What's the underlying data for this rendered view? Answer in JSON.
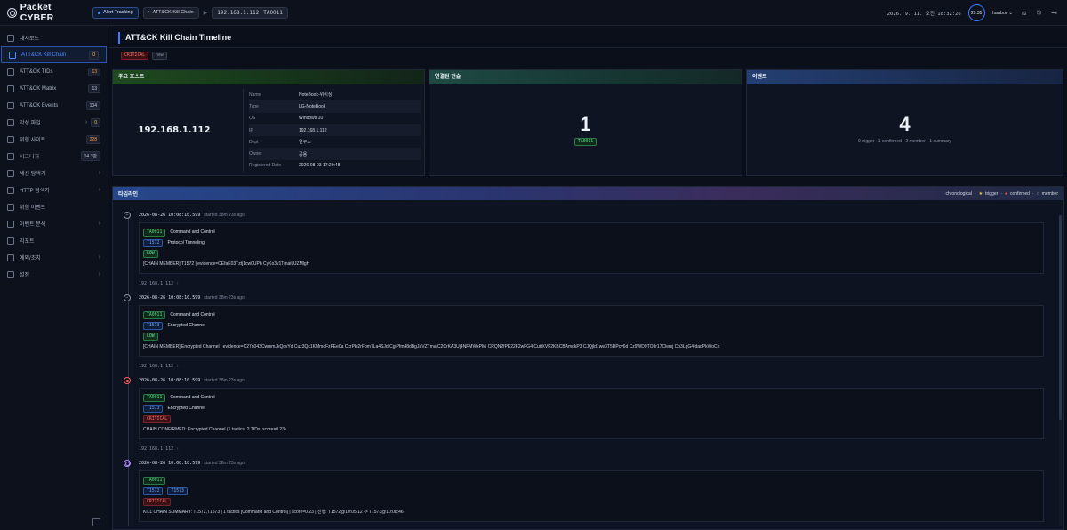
{
  "app": {
    "logo": "Packet CYBER"
  },
  "topbar": {
    "alert_label": "Alert Tracking",
    "chain_label": "ATT&CK Kill Chain",
    "ip": "192.168.1.112",
    "tactic": "TA0011",
    "datetime": "2026. 9. 11. 오전 10:32:26",
    "timer": "29:35",
    "user": "hanbor"
  },
  "sidebar": {
    "items": [
      {
        "label": "대시보드"
      },
      {
        "label": "ATT&CK Kill Chain",
        "badge": "0"
      },
      {
        "label": "ATT&CK TIDs",
        "badge": "13"
      },
      {
        "label": "ATT&CK Matrix",
        "badge": "13"
      },
      {
        "label": "ATT&CK Events",
        "badge": "104"
      },
      {
        "label": "악성 파일",
        "badge": "0"
      },
      {
        "label": "위험 사이트",
        "badge": "228"
      },
      {
        "label": "시그니처",
        "badge": "14.3만"
      },
      {
        "label": "세션 탐색기"
      },
      {
        "label": "HTTP 탐색기"
      },
      {
        "label": "위험 이벤트"
      },
      {
        "label": "이벤트 분석"
      },
      {
        "label": "리포트"
      },
      {
        "label": "예외/조치"
      },
      {
        "label": "설정"
      }
    ]
  },
  "page": {
    "title": "ATT&CK Kill Chain Timeline",
    "severity": "CRITICAL",
    "status": "new"
  },
  "host_card": {
    "title": "주요 호스트",
    "ip": "192.168.1.112",
    "rows": [
      {
        "k": "Name",
        "v": "NoteBook-위이싱"
      },
      {
        "k": "Type",
        "v": "LG-NoteBook"
      },
      {
        "k": "OS",
        "v": "Windows 10"
      },
      {
        "k": "IP",
        "v": "192.168.1.112"
      },
      {
        "k": "Dept",
        "v": "연구소"
      },
      {
        "k": "Owner",
        "v": "공용"
      },
      {
        "k": "Registered Date",
        "v": "2026-08-03 17:20:48"
      }
    ]
  },
  "tactic_card": {
    "title": "연결된 전술",
    "count": "1",
    "tag": "TA0011"
  },
  "event_card": {
    "title": "이벤트",
    "count": "4",
    "summary": "0 trigger · 1 confirmed · 2 member · 1 summary"
  },
  "timeline": {
    "title": "타임라인",
    "legend": {
      "order": "chronological",
      "trigger": "trigger",
      "confirmed": "confirmed",
      "member": "member"
    },
    "events": [
      {
        "marker": "−",
        "time": "2026-08-26 10:08:10.599",
        "started": "started 38m 23s ago",
        "tactic": "TA0011",
        "tactic_name": "Command and Control",
        "techniques": [
          "T1572"
        ],
        "technique_name": "Protocol Tunneling",
        "severity": "LOW",
        "message": "[CHAIN MEMBER] T1572 | evidence=CEfaE03Tztj1cw0UPh CyKo3v1TmaiUJZMlgH",
        "ip": "192.168.1.112"
      },
      {
        "marker": "−",
        "time": "2026-08-26 10:08:10.599",
        "started": "started 38m 23s ago",
        "tactic": "TA0011",
        "tactic_name": "Command and Control",
        "techniques": [
          "T1573"
        ],
        "technique_name": "Encrypted Channel",
        "severity": "LOW",
        "message": "[CHAIN MEMBER] Encrypted Channel | evidence=C27n043CwmmJkQcvYd Cuz3Qc1KMmqFzFEe0a CxrPki2rFbm7La4SJd CgiPfm48dBgJaVZTma C2CrKA3Uj4NFMWxPMi CRQN2fPE22F2wFG4 CuttXVF2KBCBAmqkP3 CJQjld1we3T5DPcv6d Cz9WD9TO3r17Clersj Co3LqG4fdaqPkWoCh",
        "ip": "192.168.1.112"
      },
      {
        "marker": "",
        "time": "2026-08-26 10:08:10.599",
        "started": "started 38m 23s ago",
        "tactic": "TA0011",
        "tactic_name": "Command and Control",
        "techniques": [
          "T1573"
        ],
        "technique_name": "Encrypted Channel",
        "severity": "CRITICAL",
        "message": "CHAIN CONFIRMED: Encrypted Channel (1 tactics, 2 TIDs, score=0.23)",
        "ip": "192.168.1.112"
      },
      {
        "marker": "",
        "time": "2026-08-26 10:08:10.599",
        "started": "started 38m 23s ago",
        "tactic": "TA0011",
        "techniques": [
          "T1572",
          "T1573"
        ],
        "severity": "CRITICAL",
        "message": "KILL CHAIN SUMMARY: T1572,T1573 | 1 tactics [Command and Control] | score=0.23 | 진행: T1572@10:05:12 -> T1573@10:08:46"
      }
    ]
  }
}
